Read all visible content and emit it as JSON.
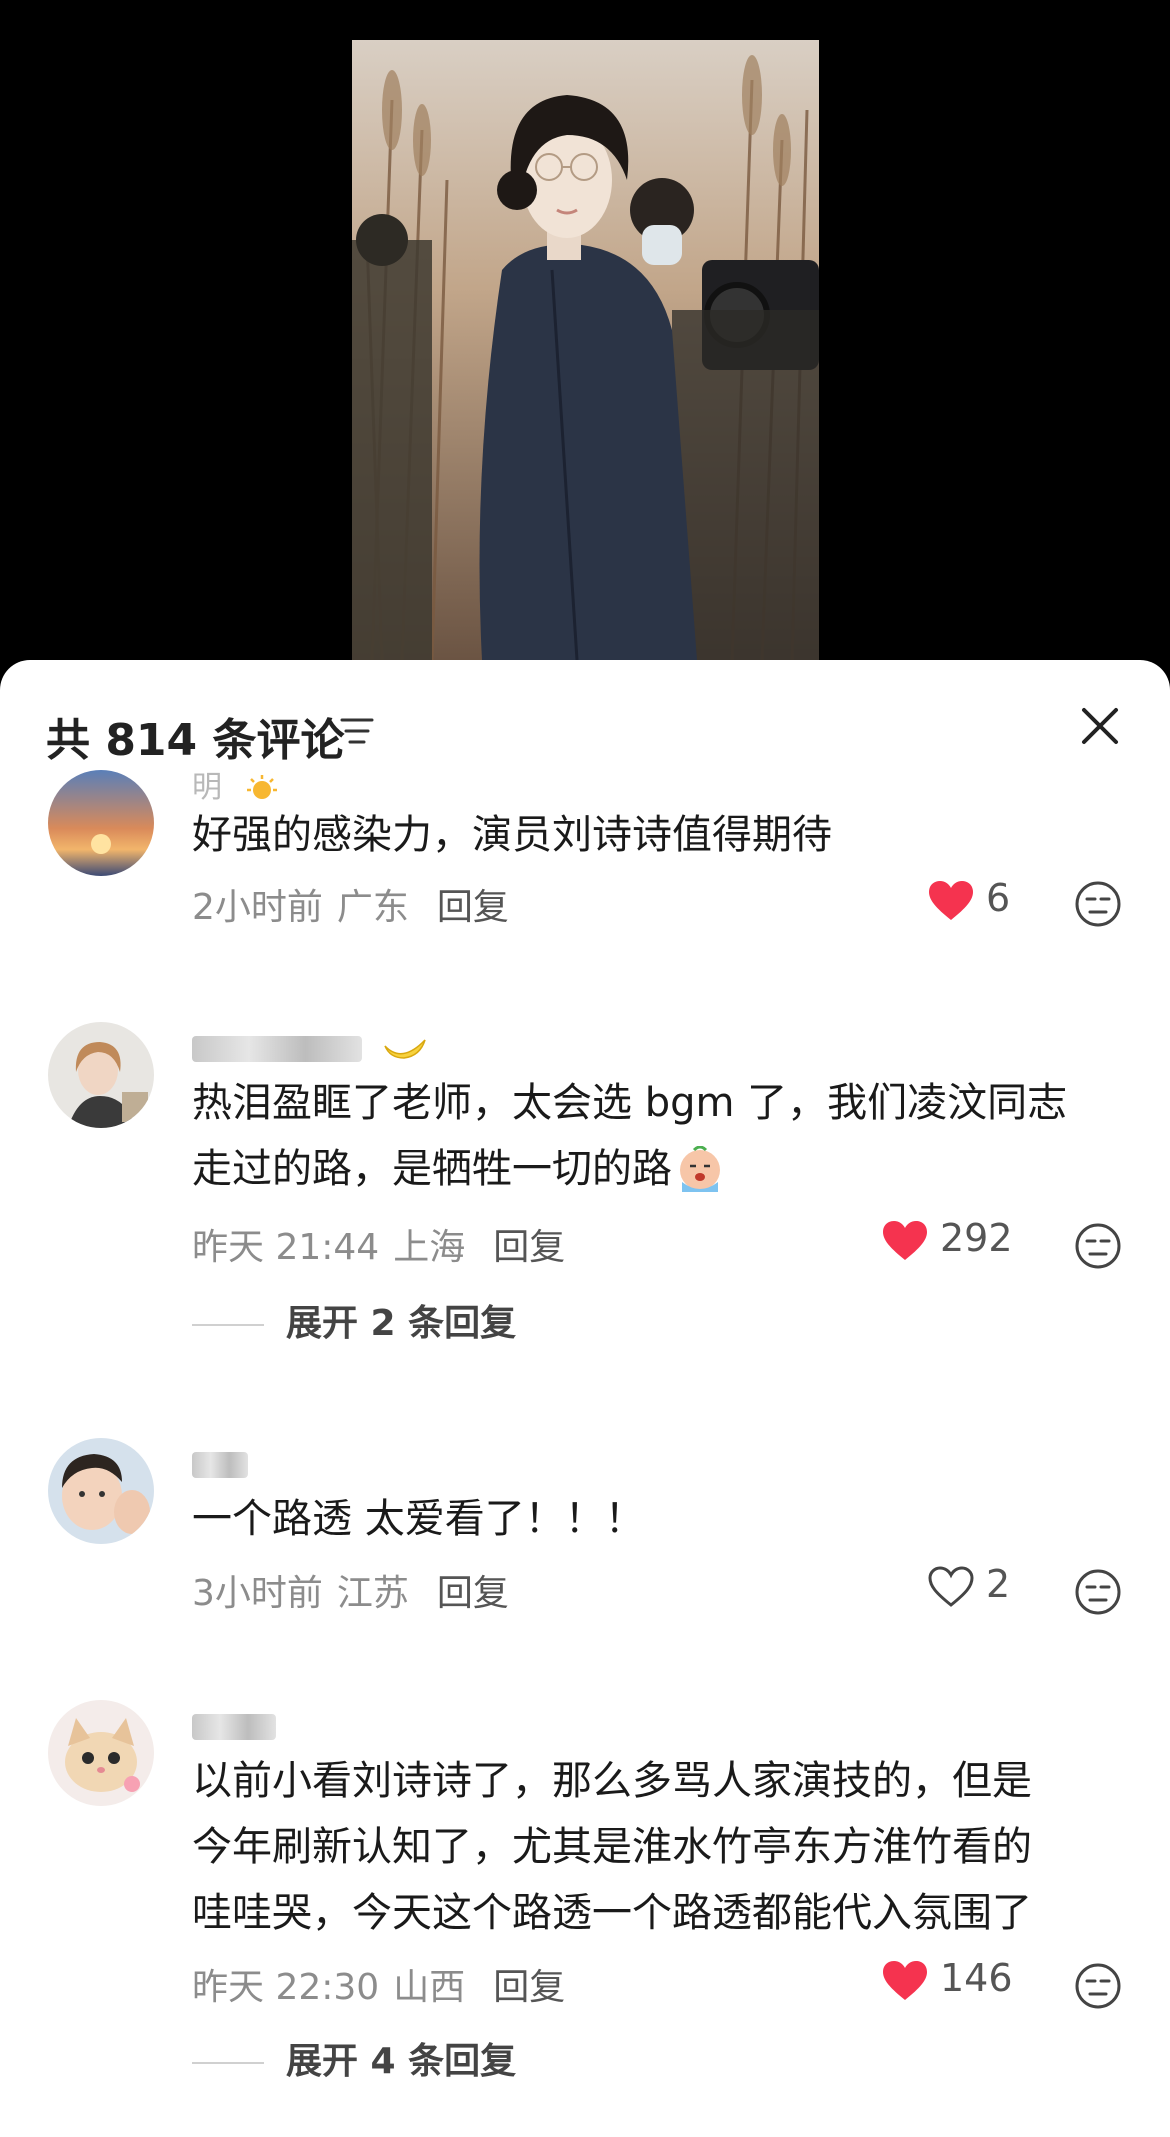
{
  "video": {
    "watermark": ""
  },
  "header": {
    "title": "共 814 条评论"
  },
  "comments": [
    {
      "username": "明",
      "text": "好强的感染力，演员刘诗诗值得期待",
      "time": "2小时前",
      "location": "广东",
      "reply": "回复",
      "likes": "6",
      "liked": true
    },
    {
      "username": "",
      "text_line1": "热泪盈眶了老师，太会选 bgm 了，我们凌汶同志",
      "text_line2": "走过的路，是牺牲一切的路",
      "time": "昨天 21:44",
      "location": "上海",
      "reply": "回复",
      "likes": "292",
      "liked": true,
      "expand": "展开 2 条回复"
    },
    {
      "username": "",
      "text": "一个路透 太爱看了！！！",
      "time": "3小时前",
      "location": "江苏",
      "reply": "回复",
      "likes": "2",
      "liked": false
    },
    {
      "username": "",
      "text_line1": "以前小看刘诗诗了，那么多骂人家演技的，但是",
      "text_line2": "今年刷新认知了，尤其是淮水竹亭东方淮竹看的",
      "text_line3": "哇哇哭，今天这个路透一个路透都能代入氛围了",
      "time": "昨天 22:30",
      "location": "山西",
      "reply": "回复",
      "likes": "146",
      "liked": true,
      "expand": "展开 4 条回复"
    }
  ],
  "colors": {
    "like_red": "#f5334f",
    "meta_gray": "#8c8c8c",
    "sheet_bg": "#ffffff"
  }
}
